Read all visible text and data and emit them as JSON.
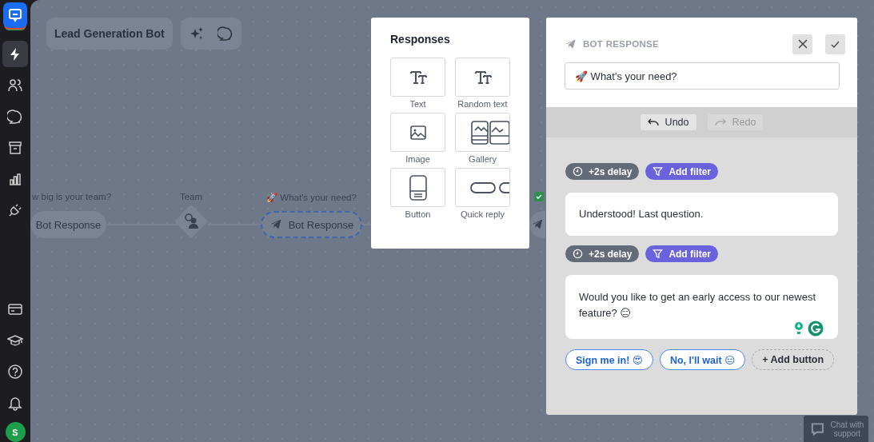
{
  "sidebar": {
    "items": [
      {
        "selected": true
      },
      {
        "selected": false
      },
      {
        "selected": false
      },
      {
        "selected": false
      },
      {
        "selected": false
      },
      {
        "selected": false
      }
    ],
    "bottom_items": [
      {
        "selected": false
      },
      {
        "selected": false
      },
      {
        "selected": false
      },
      {
        "selected": false
      }
    ],
    "avatar": "S"
  },
  "canvas": {
    "bot_name": "Lead Generation Bot",
    "nodes": [
      {
        "kind": "response",
        "caption": "w big is your team?",
        "label": "Bot Response",
        "selected": false
      },
      {
        "kind": "team",
        "caption": "Team"
      },
      {
        "kind": "response",
        "caption": "🚀 What's your need?",
        "label": "Bot Response",
        "selected": true
      },
      {
        "kind": "cut"
      }
    ]
  },
  "responses_panel": {
    "title": "Responses",
    "items": [
      {
        "label": "Text"
      },
      {
        "label": "Random text"
      },
      {
        "label": "Image"
      },
      {
        "label": "Gallery"
      },
      {
        "label": "Button"
      },
      {
        "label": "Quick reply"
      }
    ]
  },
  "editor": {
    "heading": "BOT RESPONSE",
    "name_value": "🚀 What's your need?",
    "undo": {
      "label": "Undo",
      "disabled": false
    },
    "redo": {
      "label": "Redo",
      "disabled": true
    },
    "blocks": [
      {
        "delay": "+2s delay",
        "filter": "Add filter",
        "message": "Understood! Last question."
      },
      {
        "delay": "+2s delay",
        "filter": "Add filter",
        "message": "Would you like to get an early access to our newest feature? 😑",
        "buttons": [
          {
            "label": "Sign me in! 😍"
          },
          {
            "label": "No, I'll wait 😑"
          }
        ],
        "add_button": "+ Add button"
      }
    ]
  },
  "support": "Chat with support"
}
